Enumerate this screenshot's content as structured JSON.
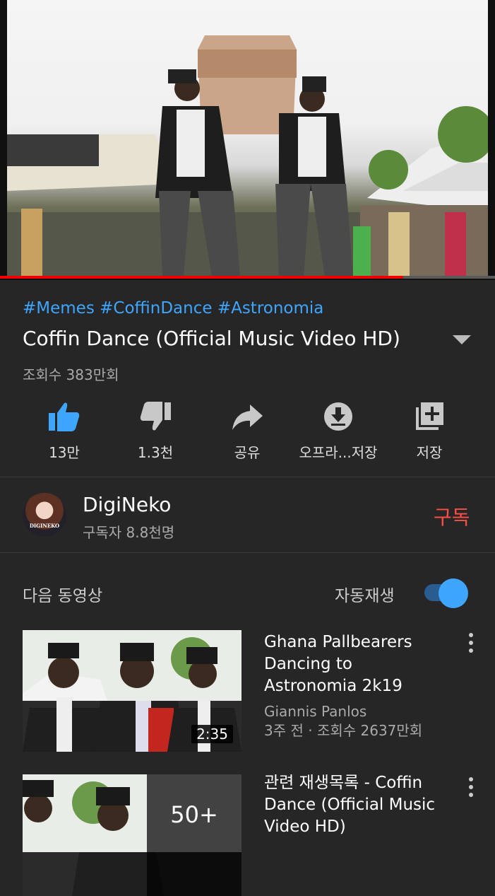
{
  "video": {
    "hashtags": "#Memes #CoffinDance #Astronomia",
    "title": "Coffin Dance (Official Music Video HD)",
    "views": "조회수 383만회",
    "progress": 0.815
  },
  "actions": [
    {
      "icon": "thumbs-up-icon",
      "label": "13만"
    },
    {
      "icon": "thumbs-down-icon",
      "label": "1.3천"
    },
    {
      "icon": "share-icon",
      "label": "공유"
    },
    {
      "icon": "download-icon",
      "label": "오프라...저장"
    },
    {
      "icon": "add-to-playlist-icon",
      "label": "저장"
    }
  ],
  "channel": {
    "name": "DigiNeko",
    "subscribers": "구독자 8.8천명",
    "subscribe_label": "구독",
    "avatar_text": "DIGINEKO"
  },
  "up_next": {
    "label": "다음 동영상",
    "autoplay_label": "자동재생",
    "autoplay_on": true
  },
  "related": [
    {
      "title_lines": [
        "Ghana Pallbearers",
        "Dancing to",
        "Astronomia 2k19"
      ],
      "channel": "Giannis Panlos",
      "meta": "3주 전 · 조회수 2637만회",
      "duration": "2:35"
    },
    {
      "title_lines": [
        "관련 재생목록 - Coffin",
        "Dance (Official Music",
        "Video HD)"
      ],
      "playlist_count": "50+"
    }
  ],
  "colors": {
    "background": "#262626",
    "accent_blue": "#3ea6ff",
    "subscribe_red": "#ff4e45",
    "progress_red": "#e00000"
  }
}
